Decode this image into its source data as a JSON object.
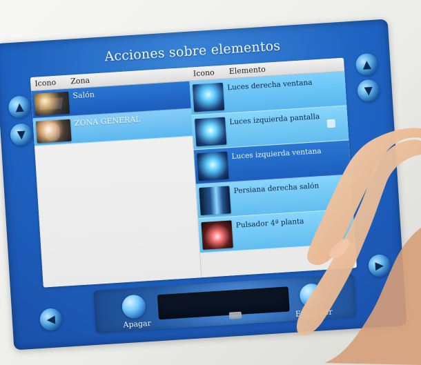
{
  "screen": {
    "title": "Acciones sobre elementos"
  },
  "zones_table": {
    "headers": [
      "Icono",
      "Zona"
    ],
    "rows": [
      {
        "label": "Salón"
      },
      {
        "label": "ZONA GENERAL"
      }
    ]
  },
  "elements_table": {
    "headers": [
      "Icono",
      "Elemento"
    ],
    "rows": [
      {
        "label": "Luces derecha ventana"
      },
      {
        "label": "Luces izquierda pantalla"
      },
      {
        "label": "Luces izquierda ventana"
      },
      {
        "label": "Persiana derecha salón"
      },
      {
        "label": "Pulsador 4ª planta"
      }
    ]
  },
  "bottom_bar": {
    "left_label": "Apagar",
    "right_label": "Encender"
  },
  "colors": {
    "selection_blue": "#1e63c3",
    "light_row_blue": "#62b7f0",
    "screen_blue": "#1e61c0"
  },
  "icons": {
    "left_nav_up": "triangle-up-icon",
    "left_nav_down": "triangle-down-icon",
    "right_nav_up": "triangle-up-icon",
    "right_nav_down": "triangle-down-icon",
    "bottom_left": "power-off-icon",
    "bottom_right": "power-on-icon"
  }
}
